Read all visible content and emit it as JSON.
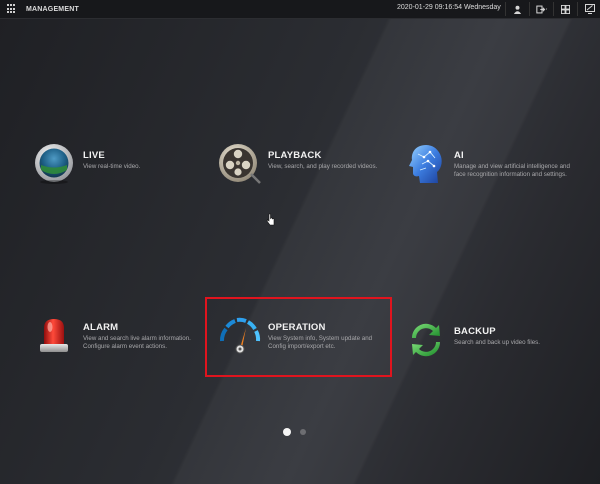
{
  "header": {
    "title": "MANAGEMENT",
    "datetime": "2020-01-29 09:16:54 Wednesday",
    "icons": [
      "grid-menu-icon",
      "user-icon",
      "logout-icon",
      "layout-icon",
      "monitor-icon"
    ]
  },
  "tiles": [
    {
      "name": "LIVE",
      "desc": "View real-time video.",
      "icon": "live-icon"
    },
    {
      "name": "PLAYBACK",
      "desc": "View, search, and play recorded videos.",
      "icon": "playback-icon"
    },
    {
      "name": "AI",
      "desc": "Manage and view artificial intelligence and face recognition information and settings.",
      "icon": "ai-icon"
    },
    {
      "name": "ALARM",
      "desc": "View and search live alarm information. Configure alarm event actions.",
      "icon": "alarm-icon"
    },
    {
      "name": "OPERATION",
      "desc": "View System info, System update and Config import/export etc.",
      "icon": "operation-icon"
    },
    {
      "name": "BACKUP",
      "desc": "Search and back up video files.",
      "icon": "backup-icon"
    }
  ],
  "pager": {
    "pages": 2,
    "current": 1
  },
  "colors": {
    "highlight": "#e0141e",
    "background": "#2b2d32"
  }
}
